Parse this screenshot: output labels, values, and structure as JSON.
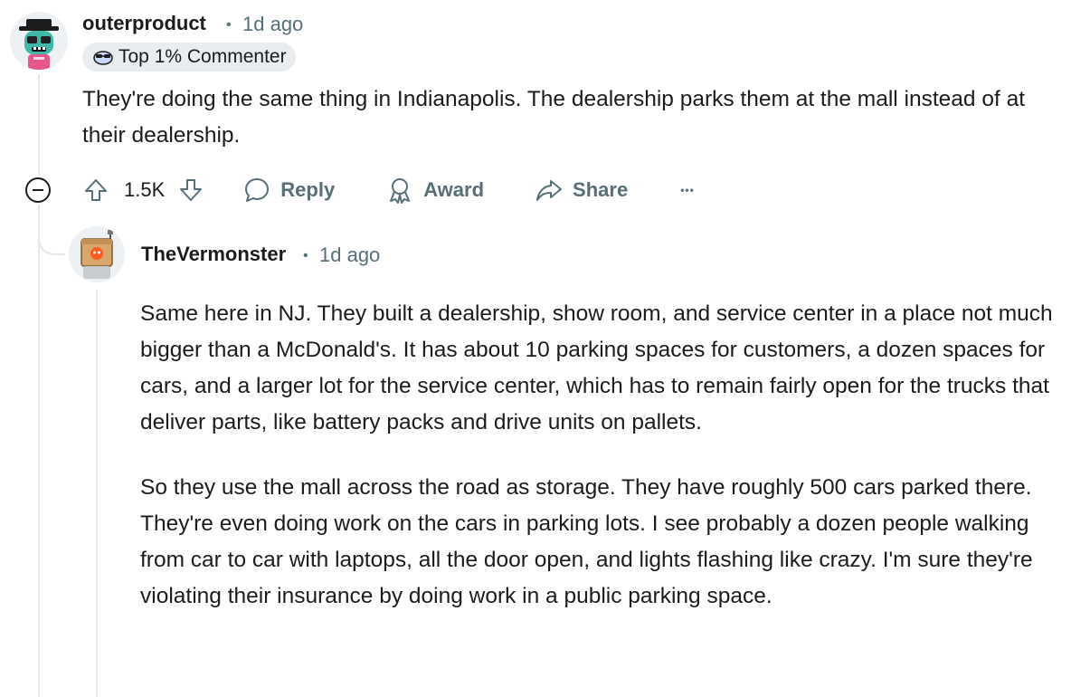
{
  "comment": {
    "username": "outerproduct",
    "separator": "•",
    "time": "1d ago",
    "flair": "Top 1% Commenter",
    "text": "They're doing the same thing in Indianapolis. The dealership parks them at the mall instead of at their dealership.",
    "actions": {
      "score": "1.5K",
      "reply": "Reply",
      "award": "Award",
      "share": "Share",
      "more": "•••"
    }
  },
  "reply": {
    "username": "TheVermonster",
    "separator": "•",
    "time": "1d ago",
    "paragraphs": [
      "Same here in NJ. They built a dealership, show room, and service center in a place not much bigger than a McDonald's. It has about 10 parking spaces for customers, a dozen spaces for cars, and a larger lot for the service center, which has to remain fairly open for the trucks that deliver parts, like battery packs and drive units on pallets.",
      "So they use the mall across the road as storage. They have roughly 500 cars parked there. They're even doing work on the cars in parking lots. I see probably a dozen people walking from car to car with laptops, all the door open, and lights flashing like crazy. I'm sure they're violating their insurance by doing work in a public parking space."
    ]
  }
}
